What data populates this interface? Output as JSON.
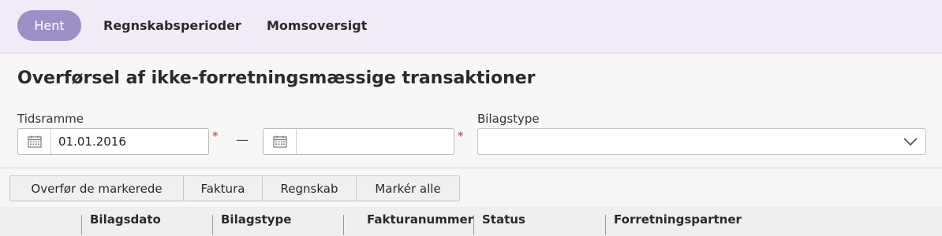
{
  "toolbar_top": {
    "hent_label": "Hent",
    "nav": [
      {
        "label": "Regnskabsperioder"
      },
      {
        "label": "Momsoversigt"
      }
    ]
  },
  "page": {
    "title": "Overførsel af ikke-forretningsmæssige transaktioner"
  },
  "filters": {
    "tidsramme_label": "Tidsramme",
    "date_from": "01.01.2016",
    "date_to": "",
    "required_marker": "*",
    "range_separator": "—",
    "bilagstype_label": "Bilagstype",
    "bilagstype_value": ""
  },
  "actions": [
    {
      "label": "Overfør de markerede"
    },
    {
      "label": "Faktura"
    },
    {
      "label": "Regnskab"
    },
    {
      "label": "Markér alle"
    }
  ],
  "table": {
    "columns": [
      "Bilagsdato",
      "Bilagstype",
      "Fakturanummer",
      "Status",
      "Forretningspartner"
    ]
  },
  "colors": {
    "accent": "#9f8fc7",
    "topbar_bg": "#f1ebf7",
    "required": "#c0392b"
  },
  "icons": [
    "calendar-icon",
    "chevron-down-icon"
  ]
}
